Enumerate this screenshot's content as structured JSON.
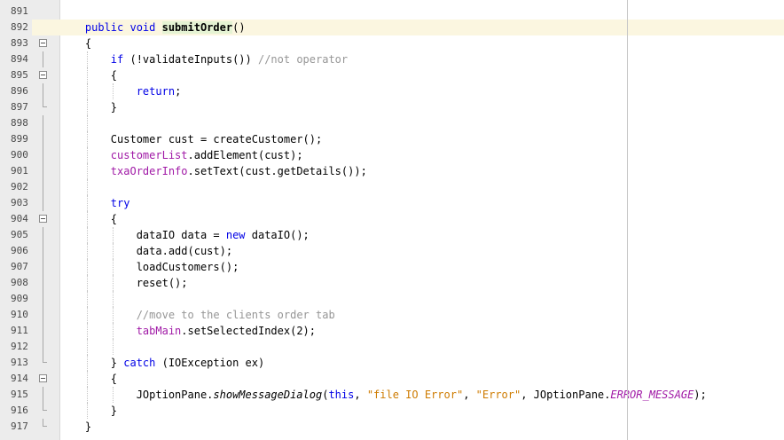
{
  "editor": {
    "colors": {
      "keyword": "#0000e6",
      "comment": "#969696",
      "string": "#ce7b00",
      "field": "#a019a6",
      "current_line": "#fbf6e0",
      "method_highlight": "#e5f3d3",
      "gutter": "#ececec"
    },
    "lines": [
      {
        "n": "891",
        "fold": "",
        "level": 0,
        "parts": []
      },
      {
        "n": "892",
        "fold": "",
        "level": 0,
        "current": true,
        "parts": [
          {
            "t": "    "
          },
          {
            "t": "public void ",
            "c": "kw"
          },
          {
            "t": "submitOrder",
            "c": "hl"
          },
          {
            "t": "()"
          }
        ]
      },
      {
        "n": "893",
        "fold": "start",
        "level": 0,
        "parts": [
          {
            "t": "    {"
          }
        ]
      },
      {
        "n": "894",
        "fold": "line",
        "level": 1,
        "parts": [
          {
            "t": "        "
          },
          {
            "t": "if",
            "c": "kw"
          },
          {
            "t": " (!validateInputs()) "
          },
          {
            "t": "//not operator",
            "c": "cm"
          }
        ]
      },
      {
        "n": "895",
        "fold": "start",
        "level": 1,
        "parts": [
          {
            "t": "        {"
          }
        ]
      },
      {
        "n": "896",
        "fold": "line",
        "level": 2,
        "parts": [
          {
            "t": "            "
          },
          {
            "t": "return",
            "c": "kw"
          },
          {
            "t": ";"
          }
        ]
      },
      {
        "n": "897",
        "fold": "end",
        "level": 1,
        "parts": [
          {
            "t": "        }"
          }
        ]
      },
      {
        "n": "898",
        "fold": "line",
        "level": 1,
        "parts": []
      },
      {
        "n": "899",
        "fold": "line",
        "level": 1,
        "parts": [
          {
            "t": "        Customer cust = createCustomer();"
          }
        ]
      },
      {
        "n": "900",
        "fold": "line",
        "level": 1,
        "parts": [
          {
            "t": "        "
          },
          {
            "t": "customerList",
            "c": "fld"
          },
          {
            "t": ".addElement(cust);"
          }
        ]
      },
      {
        "n": "901",
        "fold": "line",
        "level": 1,
        "parts": [
          {
            "t": "        "
          },
          {
            "t": "txaOrderInfo",
            "c": "fld"
          },
          {
            "t": ".setText(cust.getDetails());"
          }
        ]
      },
      {
        "n": "902",
        "fold": "line",
        "level": 1,
        "parts": []
      },
      {
        "n": "903",
        "fold": "line",
        "level": 1,
        "parts": [
          {
            "t": "        "
          },
          {
            "t": "try",
            "c": "kw"
          }
        ]
      },
      {
        "n": "904",
        "fold": "start",
        "level": 1,
        "parts": [
          {
            "t": "        {"
          }
        ]
      },
      {
        "n": "905",
        "fold": "line",
        "level": 2,
        "parts": [
          {
            "t": "            dataIO data = "
          },
          {
            "t": "new",
            "c": "kw"
          },
          {
            "t": " dataIO();"
          }
        ]
      },
      {
        "n": "906",
        "fold": "line",
        "level": 2,
        "parts": [
          {
            "t": "            data.add(cust);"
          }
        ]
      },
      {
        "n": "907",
        "fold": "line",
        "level": 2,
        "parts": [
          {
            "t": "            loadCustomers();"
          }
        ]
      },
      {
        "n": "908",
        "fold": "line",
        "level": 2,
        "parts": [
          {
            "t": "            reset();"
          }
        ]
      },
      {
        "n": "909",
        "fold": "line",
        "level": 2,
        "parts": []
      },
      {
        "n": "910",
        "fold": "line",
        "level": 2,
        "parts": [
          {
            "t": "            "
          },
          {
            "t": "//move to the clients order tab",
            "c": "cm"
          }
        ]
      },
      {
        "n": "911",
        "fold": "line",
        "level": 2,
        "parts": [
          {
            "t": "            "
          },
          {
            "t": "tabMain",
            "c": "fld"
          },
          {
            "t": ".setSelectedIndex(2);"
          }
        ]
      },
      {
        "n": "912",
        "fold": "line",
        "level": 2,
        "parts": []
      },
      {
        "n": "913",
        "fold": "end",
        "level": 1,
        "parts": [
          {
            "t": "        } "
          },
          {
            "t": "catch",
            "c": "kw"
          },
          {
            "t": " (IOException ex)"
          }
        ]
      },
      {
        "n": "914",
        "fold": "start",
        "level": 1,
        "parts": [
          {
            "t": "        {"
          }
        ]
      },
      {
        "n": "915",
        "fold": "line",
        "level": 2,
        "parts": [
          {
            "t": "            JOptionPane."
          },
          {
            "t": "showMessageDialog",
            "c": "ital"
          },
          {
            "t": "("
          },
          {
            "t": "this",
            "c": "kw"
          },
          {
            "t": ", "
          },
          {
            "t": "\"file IO Error\"",
            "c": "str"
          },
          {
            "t": ", "
          },
          {
            "t": "\"Error\"",
            "c": "str"
          },
          {
            "t": ", JOptionPane."
          },
          {
            "t": "ERROR_MESSAGE",
            "c": "fld ital"
          },
          {
            "t": ");"
          }
        ]
      },
      {
        "n": "916",
        "fold": "end",
        "level": 1,
        "parts": [
          {
            "t": "        }"
          }
        ]
      },
      {
        "n": "917",
        "fold": "end",
        "level": 0,
        "parts": [
          {
            "t": "    }"
          }
        ]
      }
    ]
  }
}
